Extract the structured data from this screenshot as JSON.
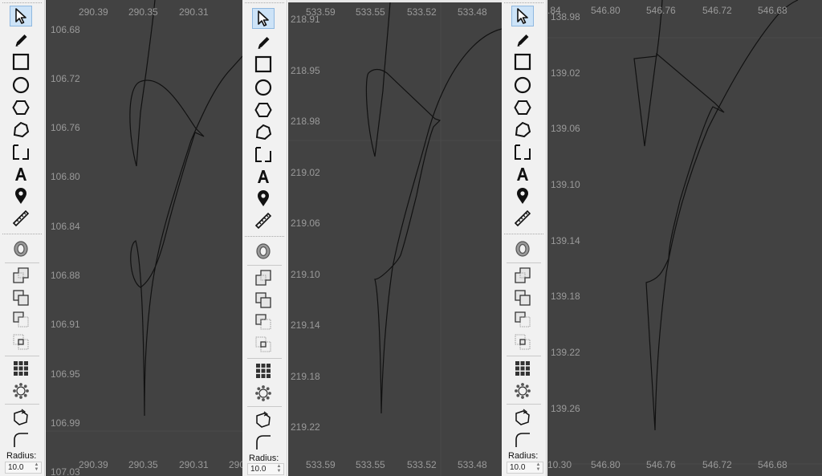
{
  "tools": [
    {
      "name": "select-tool",
      "icon": "arrow-pointer-icon",
      "selected": true
    },
    {
      "name": "pencil-tool",
      "icon": "pencil-icon"
    },
    {
      "name": "rectangle-tool",
      "icon": "rectangle-icon"
    },
    {
      "name": "circle-tool",
      "icon": "circle-icon"
    },
    {
      "name": "hexagon-tool",
      "icon": "hexagon-icon"
    },
    {
      "name": "polygon-tool",
      "icon": "polygon-icon"
    },
    {
      "name": "bracket-tool",
      "icon": "bracket-icon"
    },
    {
      "name": "text-tool",
      "icon": "text-icon"
    },
    {
      "name": "marker-tool",
      "icon": "map-pin-icon"
    },
    {
      "name": "ruler-tool",
      "icon": "ruler-icon"
    },
    {
      "name": "ring-tool",
      "icon": "ring-icon"
    },
    {
      "name": "union-tool",
      "icon": "union-icon"
    },
    {
      "name": "merge-tool",
      "icon": "merge-icon"
    },
    {
      "name": "subtract-tool",
      "icon": "subtract-icon"
    },
    {
      "name": "intersect-tool",
      "icon": "intersect-icon"
    },
    {
      "name": "grid-tool",
      "icon": "grid-icon"
    },
    {
      "name": "circular-array-tool",
      "icon": "circular-array-icon"
    },
    {
      "name": "reshape-tool",
      "icon": "reshape-icon"
    },
    {
      "name": "round-corner-tool",
      "icon": "round-corner-icon"
    }
  ],
  "radius": {
    "label": "Radius:",
    "value": "10.0"
  },
  "panels": [
    {
      "x_ticks_top": [
        "290.39",
        "290.35",
        "290.31"
      ],
      "x_ticks_bottom": [
        "290.39",
        "290.35",
        "290.31",
        "290.2"
      ],
      "y_ticks": [
        "106.68",
        "106.72",
        "106.76",
        "106.80",
        "106.84",
        "106.88",
        "106.91",
        "106.95",
        "106.99",
        "107.03"
      ]
    },
    {
      "x_ticks_top": [
        "533.59",
        "533.55",
        "533.52",
        "533.48"
      ],
      "x_ticks_bottom": [
        "533.59",
        "533.55",
        "533.52",
        "533.48"
      ],
      "y_ticks": [
        "218.91",
        "218.95",
        "218.98",
        "219.02",
        "219.06",
        "219.10",
        "219.14",
        "219.18",
        "219.22"
      ]
    },
    {
      "x_ticks_top": [
        "546.80",
        "546.76",
        "546.72",
        "546.68",
        ".84"
      ],
      "x_ticks_bottom": [
        "546.80",
        "546.76",
        "546.72",
        "546.68",
        "10.30"
      ],
      "y_ticks": [
        "138.98",
        "139.02",
        "139.06",
        "139.10",
        "139.14",
        "139.18",
        "139.22",
        "139.26"
      ]
    }
  ],
  "colors": {
    "canvas_bg": "#424242",
    "tick_text": "#9a9a9a",
    "stroke": "#111111",
    "toolbar_bg": "#f1f1f1",
    "selected_bg": "#cde3f7"
  }
}
